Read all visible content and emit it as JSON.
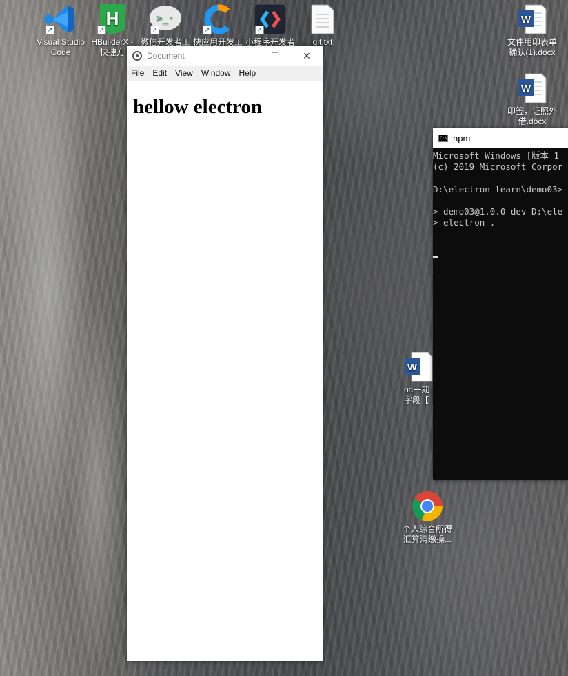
{
  "desktop": {
    "icons": [
      {
        "label": "Visual Studio Code",
        "icon": "vscode-icon"
      },
      {
        "label": "HBuilderX - 快捷方",
        "icon": "hbuilderx-icon"
      },
      {
        "label": "微信开发者工",
        "icon": "wechat-devtools-icon"
      },
      {
        "label": "快应用开发工",
        "icon": "quickapp-icon"
      },
      {
        "label": "小程序开发者",
        "icon": "miniprogram-icon"
      },
      {
        "label": "git.txt",
        "icon": "text-file-icon"
      },
      {
        "label": "文件用印表单确认(1).docx",
        "icon": "word-icon"
      },
      {
        "label": "印签，证照外借.docx",
        "icon": "word-icon"
      },
      {
        "label": "oa一期字段【",
        "icon": "word-icon"
      },
      {
        "label": "个人综合所得汇算清缴操...",
        "icon": "chrome-icon"
      }
    ]
  },
  "electron_window": {
    "title": "Document",
    "minimize": "—",
    "maximize": "☐",
    "close": "✕",
    "menu": [
      "File",
      "Edit",
      "View",
      "Window",
      "Help"
    ],
    "heading": "hellow electron"
  },
  "console": {
    "title": "npm",
    "icon_text": "C:\\",
    "lines": [
      "Microsoft Windows [版本 1",
      "(c) 2019 Microsoft Corpor",
      "",
      "D:\\electron-learn\\demo03>",
      "",
      "> demo03@1.0.0 dev D:\\ele",
      "> electron ."
    ]
  },
  "colors": {
    "console_bg": "#0c0c0c",
    "word_blue": "#2b5797",
    "hbuilder_green": "#2aa84a",
    "vscode_blue": "#1e88e5"
  }
}
